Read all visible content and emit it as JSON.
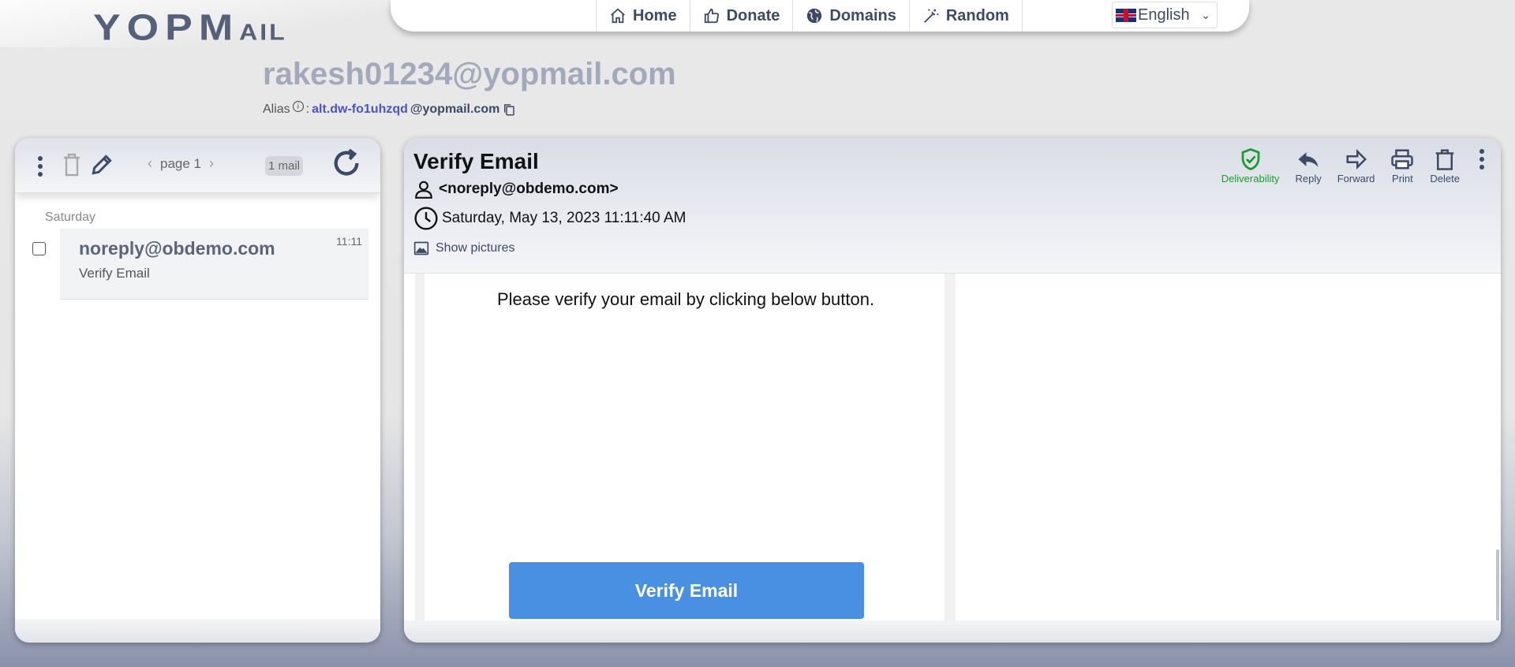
{
  "logo": {
    "text_main": "YOPM",
    "text_small": "AIL"
  },
  "nav": {
    "items": [
      {
        "label": "Home",
        "icon": "home-icon"
      },
      {
        "label": "Donate",
        "icon": "thumbs-up-icon"
      },
      {
        "label": "Domains",
        "icon": "globe-icon"
      },
      {
        "label": "Random",
        "icon": "magic-wand-icon"
      }
    ],
    "language": "English"
  },
  "inbox": {
    "address": "rakesh01234@yopmail.com",
    "alias_label": "Alias",
    "alias_sep": ":",
    "alias_local": "alt.dw-fo1uhzqd",
    "alias_domain": "@yopmail.com"
  },
  "list": {
    "page_label": "page 1",
    "mail_count": "1 mail",
    "day_label": "Saturday",
    "items": [
      {
        "from": "noreply@obdemo.com",
        "subject": "Verify Email",
        "time": "11:11"
      }
    ]
  },
  "message": {
    "subject": "Verify Email",
    "from": "<noreply@obdemo.com>",
    "date": "Saturday, May 13, 2023 11:11:40 AM",
    "show_pictures": "Show pictures",
    "actions": {
      "deliverability": "Deliverability",
      "reply": "Reply",
      "forward": "Forward",
      "print": "Print",
      "delete": "Delete"
    },
    "body_text": "Please verify your email by clicking below button.",
    "button_label": "Verify Email"
  },
  "colors": {
    "accent": "#3c4a67",
    "verify_button": "#4a90e2",
    "deliverability": "#1a9b2e",
    "alias_link": "#4a55c8"
  }
}
